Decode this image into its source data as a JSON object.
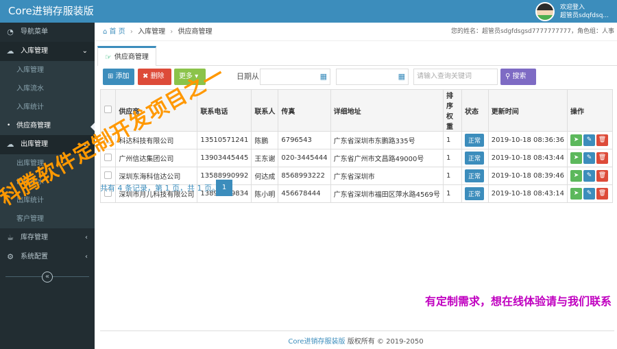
{
  "app": {
    "brand": "Core进销存服装版"
  },
  "user": {
    "greeting": "欢迎登入",
    "name": "超管员sdqfdsq..."
  },
  "sidebar": {
    "nav_title": "导航菜单",
    "inbound": {
      "label": "入库管理",
      "items": [
        "入库管理",
        "入库流水",
        "入库统计",
        "供应商管理"
      ]
    },
    "outbound": {
      "label": "出库管理",
      "items": [
        "出库管理",
        "出库流水",
        "出库统计",
        "客户管理"
      ]
    },
    "stock": {
      "label": "库存管理"
    },
    "settings": {
      "label": "系统配置"
    }
  },
  "breadcrumb": {
    "home": "首 页",
    "level1": "入库管理",
    "level2": "供应商管理",
    "right": "您的姓名：超管员sdgfdsgsd7777777777，角色组：人事"
  },
  "tab": {
    "label": "供应商管理"
  },
  "toolbar": {
    "add": "添加",
    "delete": "删除",
    "more": "更多",
    "date_label": "日期从",
    "search_placeholder": "请输入查询关键词",
    "search": "搜索"
  },
  "table": {
    "headers": [
      "供应商",
      "联系电话",
      "联系人",
      "传真",
      "详细地址",
      "排序权重",
      "状态",
      "更新时间",
      "操作"
    ],
    "rows": [
      {
        "supplier": "科达科技有限公司",
        "phone": "13510571241",
        "contact": "陈鹏",
        "fax": "6796543",
        "address": "广东省深圳市东鹏路335号",
        "weight": "1",
        "status": "正常",
        "time": "2019-10-18 08:36:36"
      },
      {
        "supplier": "广州信达集团公司",
        "phone": "13903445445",
        "contact": "王东谢",
        "fax": "020-3445444",
        "address": "广东省广州市文昌路49000号",
        "weight": "1",
        "status": "正常",
        "time": "2019-10-18 08:43:44"
      },
      {
        "supplier": "深圳东海科信达公司",
        "phone": "13588990992",
        "contact": "何达成",
        "fax": "8568993222",
        "address": "广东省深圳市",
        "weight": "1",
        "status": "正常",
        "time": "2019-10-18 08:39:46"
      },
      {
        "supplier": "深圳市月儿科技有限公司",
        "phone": "13890999834",
        "contact": "陈小明",
        "fax": "456678444",
        "address": "广东省深圳市福田区萍水路4569号",
        "weight": "1",
        "status": "正常",
        "time": "2019-10-18 08:43:14"
      }
    ]
  },
  "pager": {
    "summary": "共有 4 条记录，第 1 页，共 1 页。",
    "current": "1"
  },
  "watermark": "科腾软件定制开发项目之一",
  "promo": "有定制需求，想在线体验请与我们联系",
  "footer": {
    "brand": "Core进销存服装版",
    "rest": " 版权所有 © 2019-2050"
  }
}
